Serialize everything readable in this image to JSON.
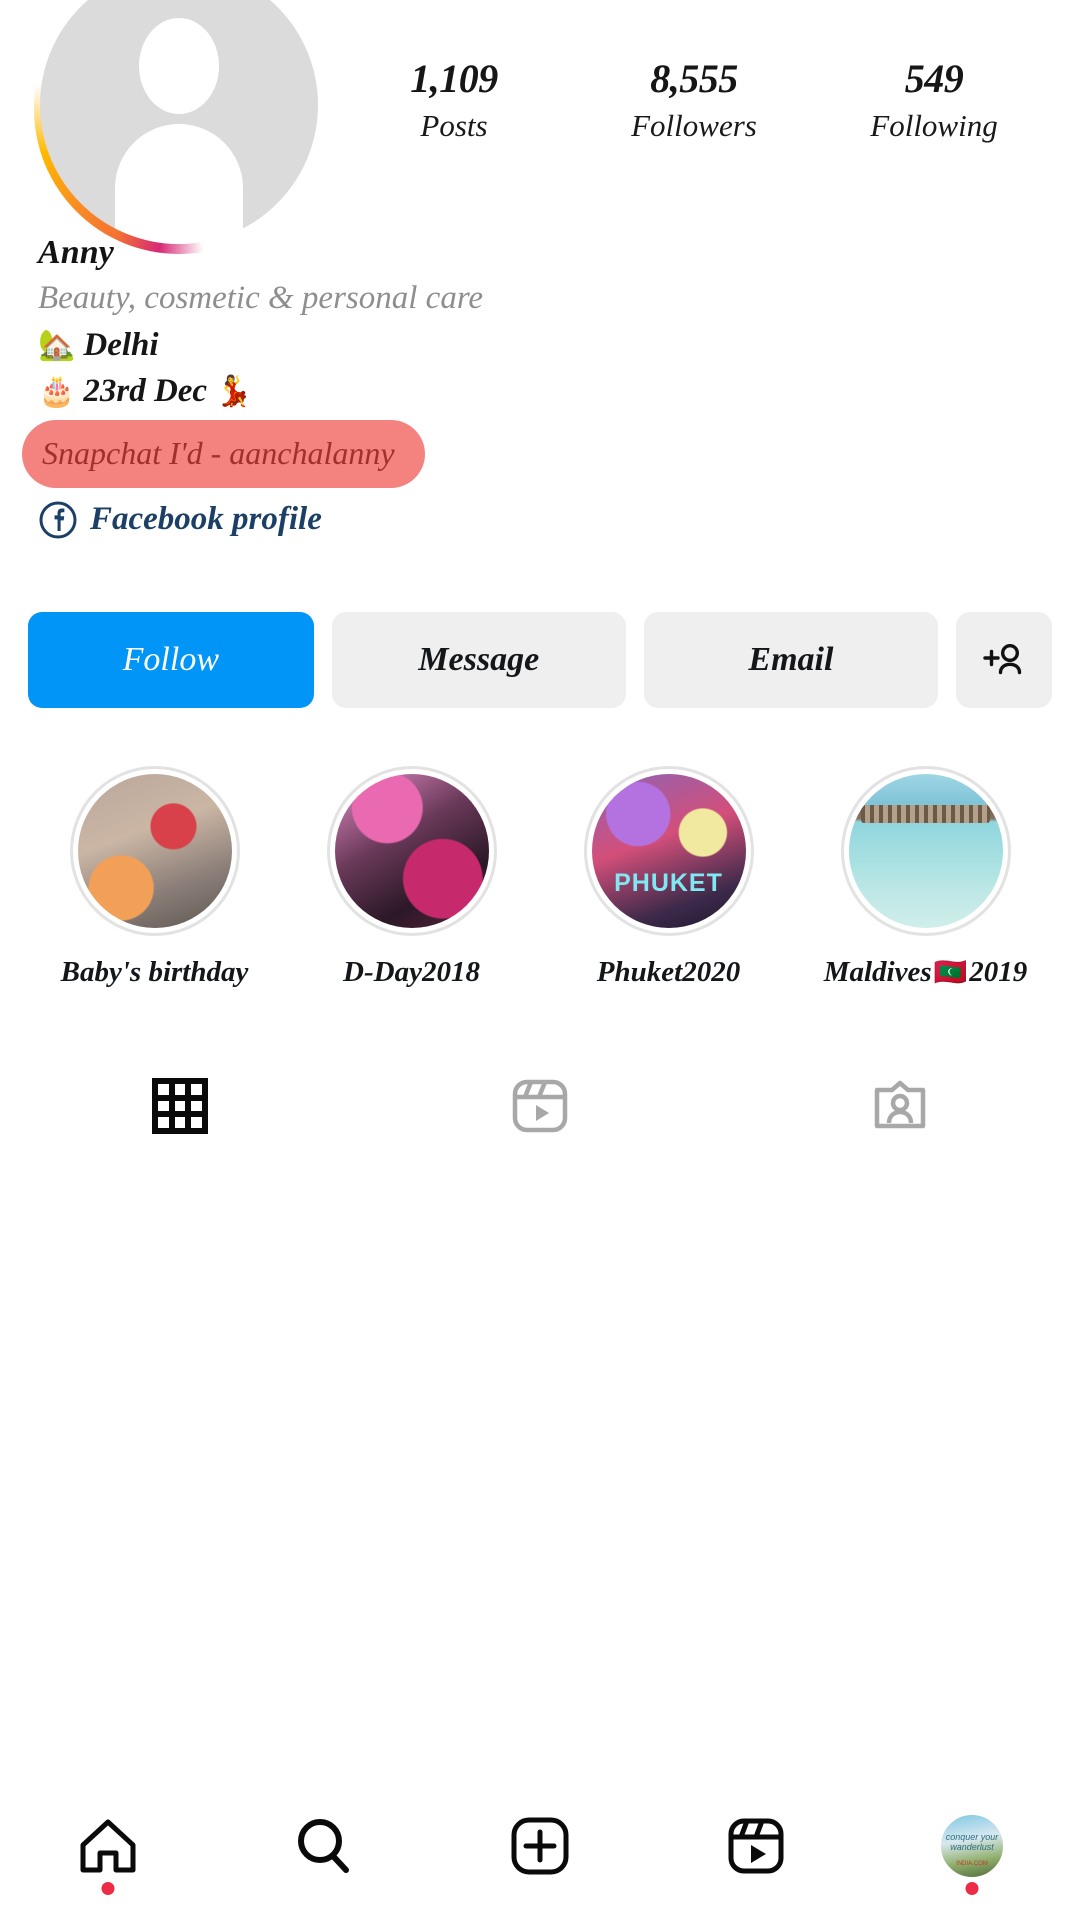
{
  "profile": {
    "name": "Anny",
    "category": "Beauty, cosmetic & personal care",
    "avatar_icon": "person-placeholder-icon",
    "has_story_ring": true
  },
  "stats": [
    {
      "value": "1,109",
      "label": "Posts",
      "name": "posts"
    },
    {
      "value": "8,555",
      "label": "Followers",
      "name": "followers"
    },
    {
      "value": "549",
      "label": "Following",
      "name": "following"
    }
  ],
  "bio": {
    "location_emoji": "🏡",
    "location": "Delhi",
    "birthday_emoji": "🎂",
    "birthday": "23rd Dec",
    "birthday_emoji2": "💃",
    "snapchat": "Snapchat I'd - aanchalanny",
    "snapchat_bg": "#f4837f",
    "snapchat_fg": "#a0302b",
    "facebook_label": "Facebook profile",
    "facebook_color": "#1c3f66"
  },
  "actions": {
    "follow": "Follow",
    "follow_color": "#0095f6",
    "message": "Message",
    "email": "Email",
    "add_person_icon": "add-person-icon"
  },
  "highlights": [
    {
      "label": "Baby's birthday",
      "emoji": ""
    },
    {
      "label": "D-Day2018",
      "emoji": ""
    },
    {
      "label": "Phuket2020",
      "emoji": "",
      "overlay_text": "PHUKET"
    },
    {
      "label": "Maldives",
      "emoji": "🇲🇻",
      "label_suffix": "2019"
    }
  ],
  "tabs": [
    {
      "name": "grid",
      "icon": "grid-icon",
      "active": true
    },
    {
      "name": "reels",
      "icon": "reels-icon",
      "active": false
    },
    {
      "name": "tagged",
      "icon": "tagged-icon",
      "active": false
    }
  ],
  "bottom_nav": [
    {
      "name": "home",
      "icon": "home-icon",
      "badge": true
    },
    {
      "name": "search",
      "icon": "search-icon",
      "badge": false
    },
    {
      "name": "create",
      "icon": "plus-box-icon",
      "badge": false
    },
    {
      "name": "reels",
      "icon": "reels-icon",
      "badge": false
    },
    {
      "name": "profile",
      "icon": "profile-avatar-icon",
      "badge": true,
      "avatar_text": "conquer your wanderlust",
      "avatar_sub": "INDIA.COM"
    }
  ]
}
